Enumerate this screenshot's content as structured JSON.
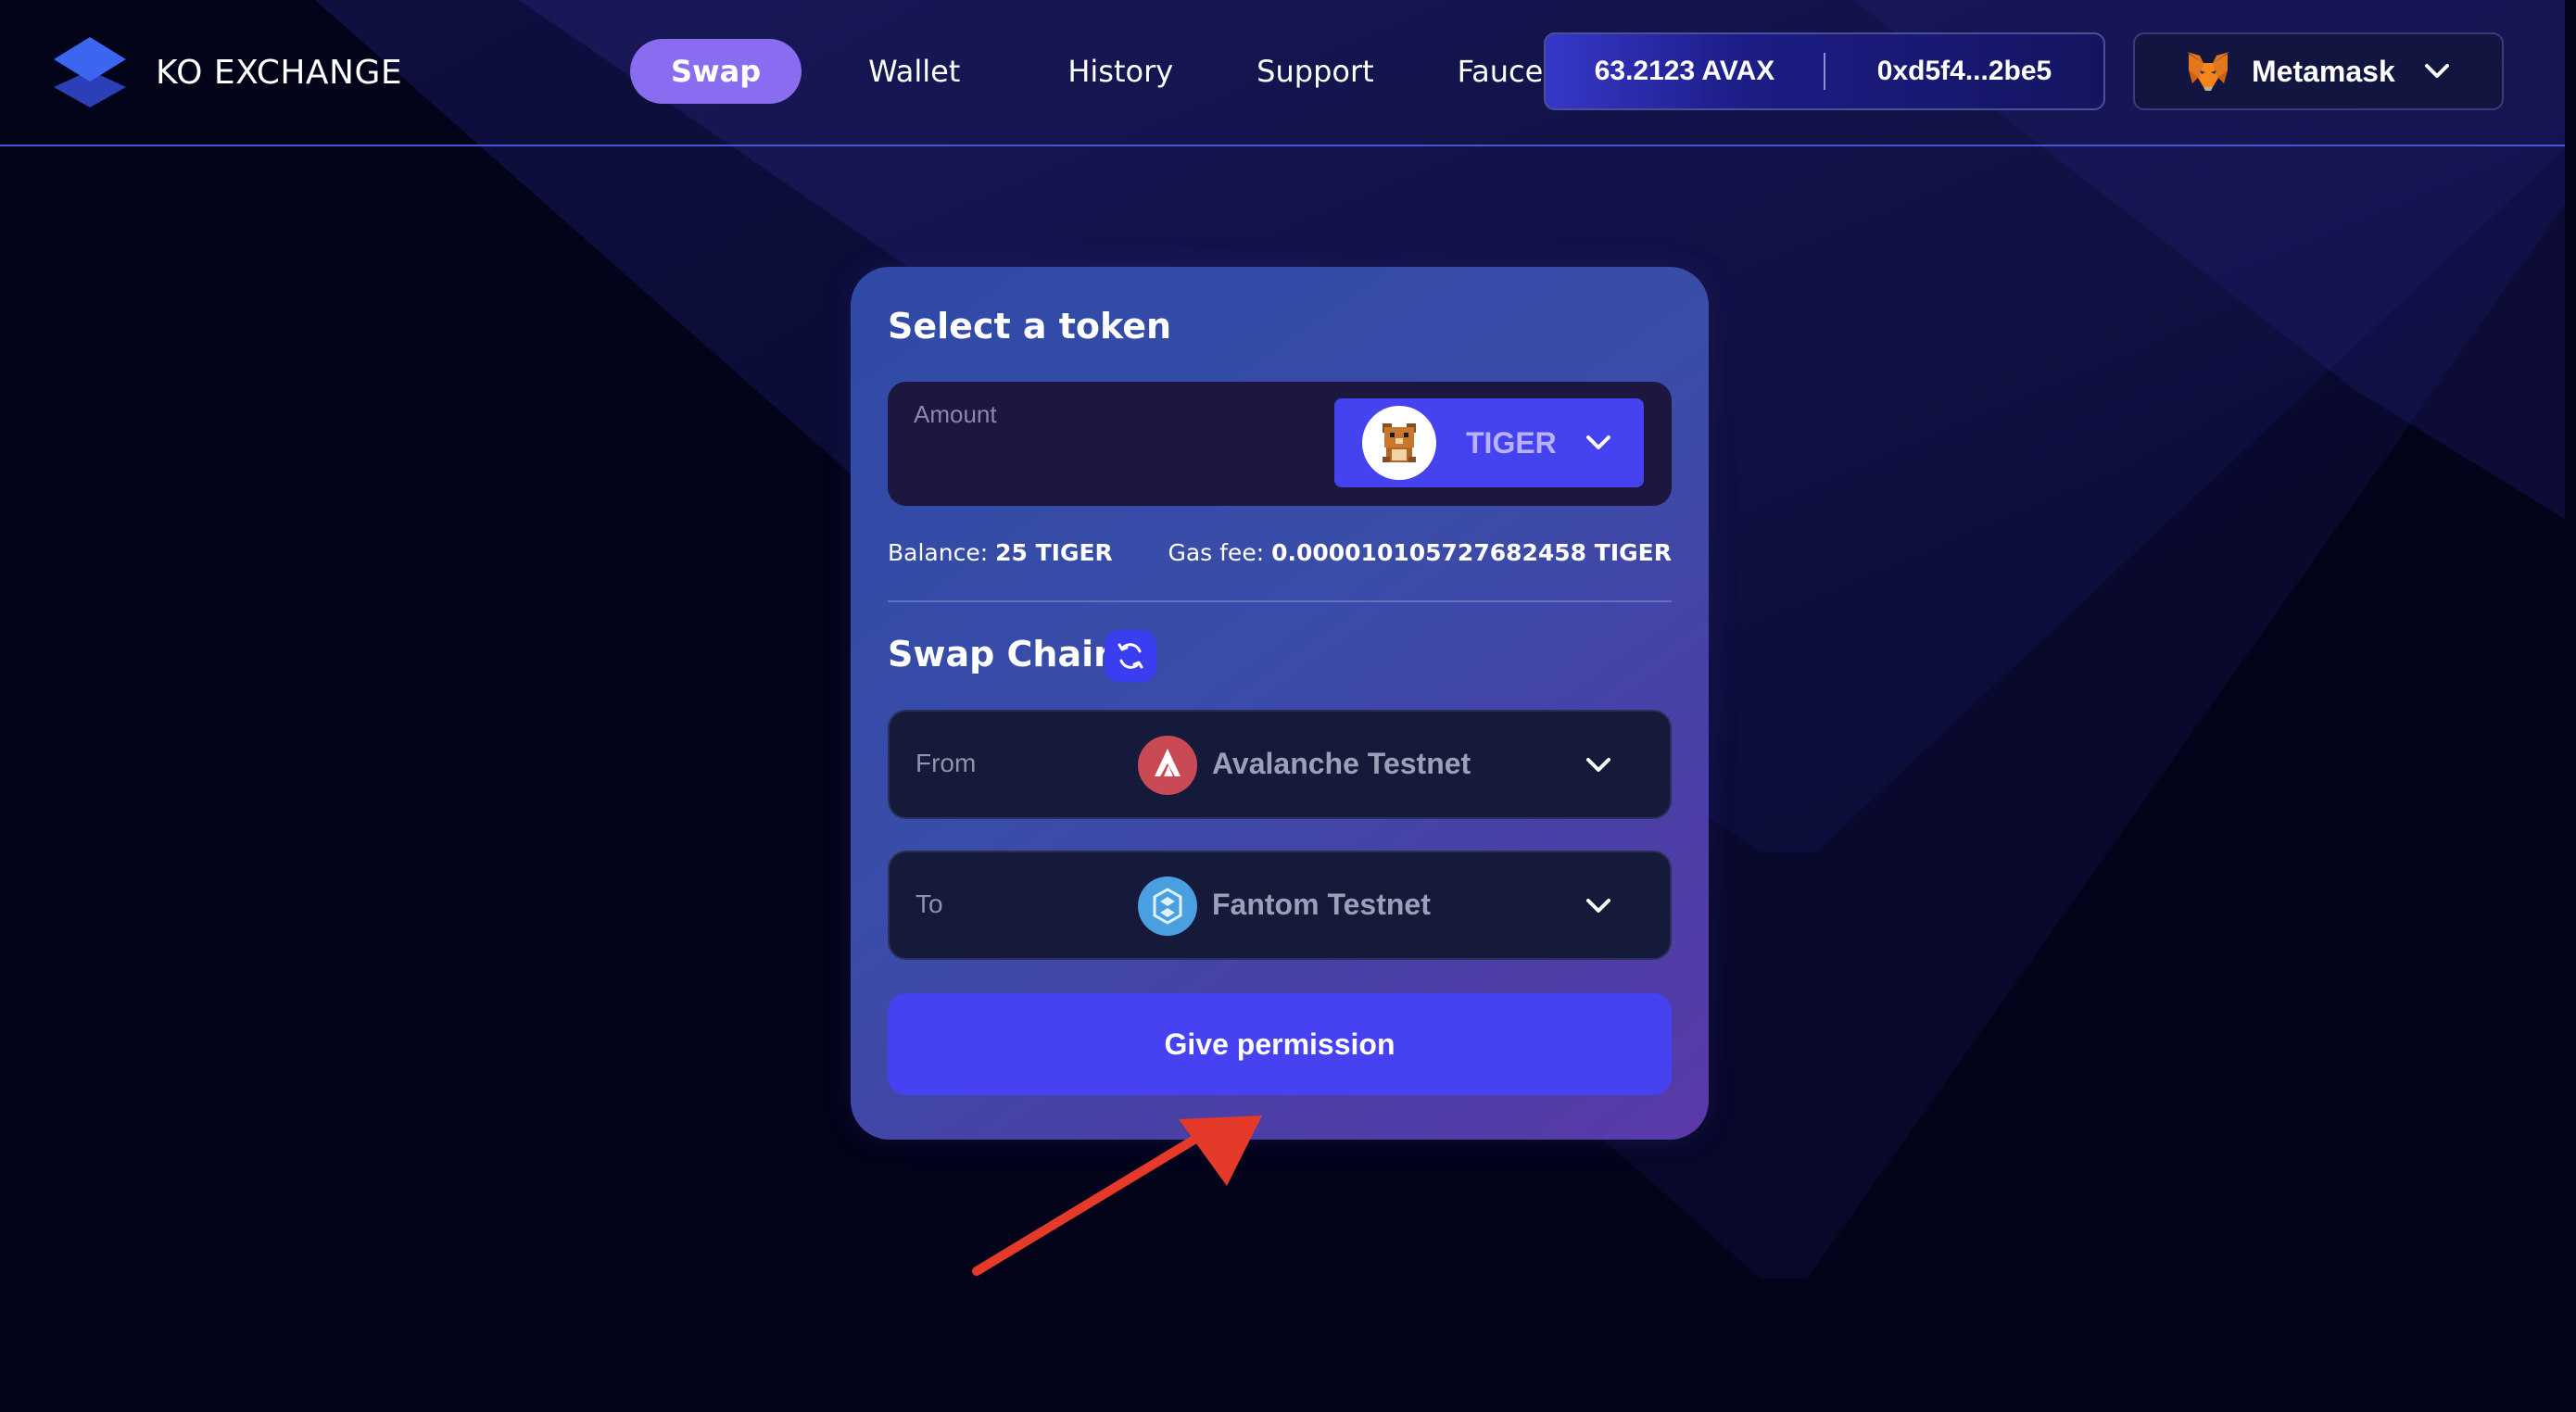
{
  "app": {
    "name": "KO EXCHANGE"
  },
  "nav": {
    "items": [
      {
        "label": "Swap",
        "active": true
      },
      {
        "label": "Wallet",
        "active": false
      },
      {
        "label": "History",
        "active": false
      },
      {
        "label": "Support",
        "active": false
      },
      {
        "label": "Faucet",
        "active": false
      }
    ]
  },
  "account": {
    "balance": "63.2123 AVAX",
    "address": "0xd5f4...2be5"
  },
  "wallet": {
    "label": "Metamask",
    "icon": "metamask-fox-icon"
  },
  "card": {
    "title": "Select a token",
    "amount": {
      "label": "Amount",
      "value": ""
    },
    "token": {
      "name": "TIGER",
      "icon": "tiger-token-icon"
    },
    "balance_label": "Balance:",
    "balance_value": "25 TIGER",
    "gas_label": "Gas fee:",
    "gas_value": "0.000010105727682458 TIGER",
    "swap_title": "Swap Chain",
    "from": {
      "label": "From",
      "chain": "Avalanche Testnet",
      "icon": "avalanche-icon",
      "color": "#e84142"
    },
    "to": {
      "label": "To",
      "chain": "Fantom Testnet",
      "icon": "fantom-icon",
      "color": "#1969ff"
    },
    "action_label": "Give permission"
  },
  "colors": {
    "accent": "#4642f2",
    "nav_active": "#8a6cf0",
    "annotation_arrow": "#e53a2a"
  }
}
